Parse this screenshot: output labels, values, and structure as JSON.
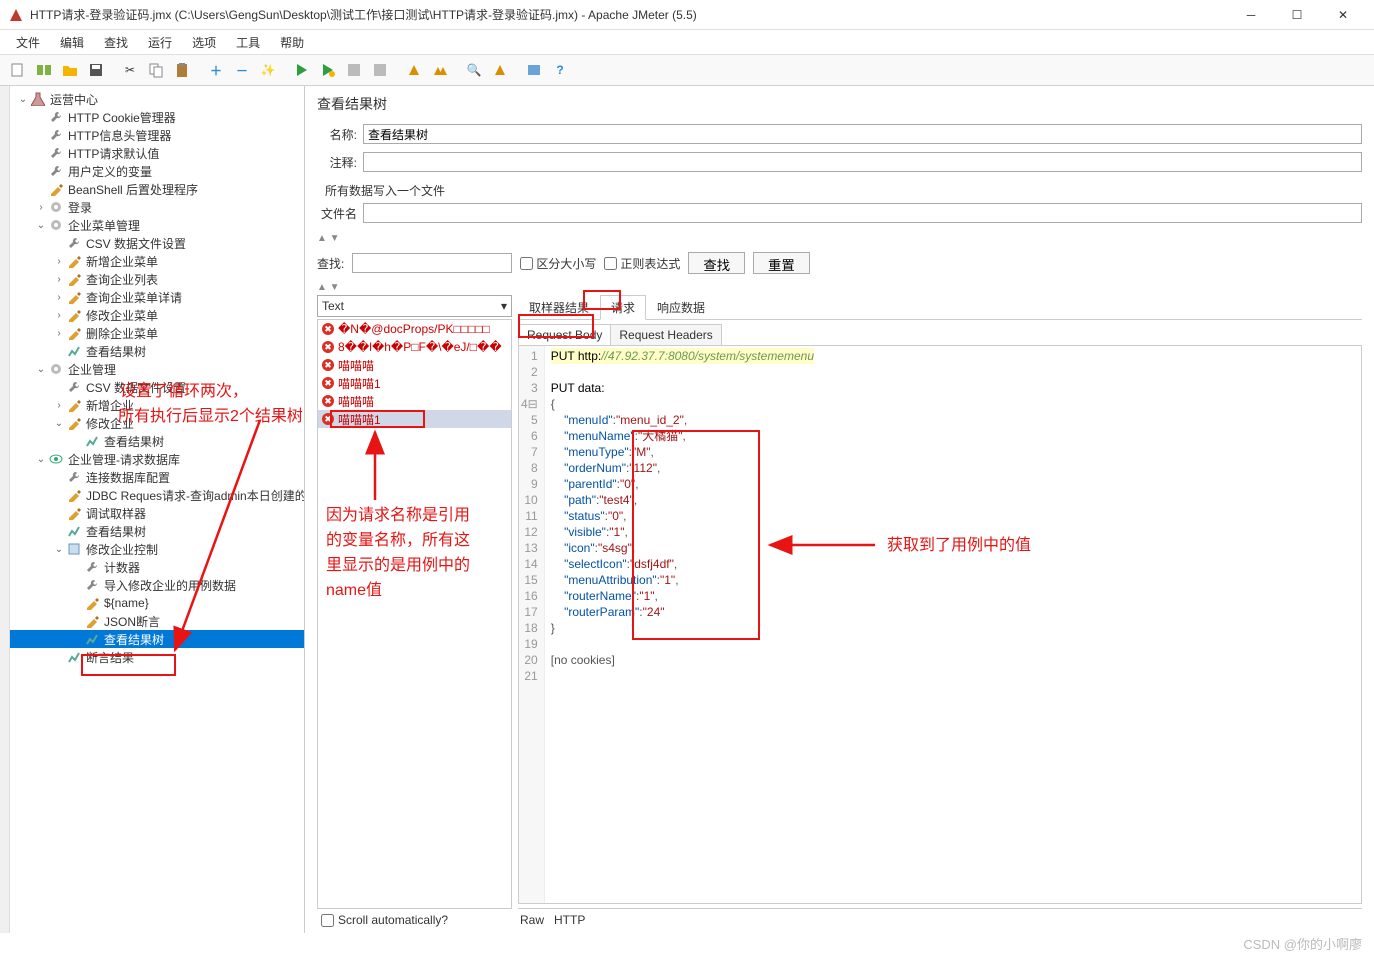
{
  "window": {
    "title": "HTTP请求-登录验证码.jmx (C:\\Users\\GengSun\\Desktop\\测试工作\\接口测试\\HTTP请求-登录验证码.jmx) - Apache JMeter (5.5)"
  },
  "menu": [
    "文件",
    "编辑",
    "查找",
    "运行",
    "选项",
    "工具",
    "帮助"
  ],
  "tree": [
    {
      "d": 0,
      "t": "v",
      "ic": "flask",
      "lbl": "运营中心"
    },
    {
      "d": 1,
      "t": "",
      "ic": "wrench",
      "lbl": "HTTP Cookie管理器"
    },
    {
      "d": 1,
      "t": "",
      "ic": "wrench",
      "lbl": "HTTP信息头管理器"
    },
    {
      "d": 1,
      "t": "",
      "ic": "wrench",
      "lbl": "HTTP请求默认值"
    },
    {
      "d": 1,
      "t": "",
      "ic": "wrench",
      "lbl": "用户定义的变量"
    },
    {
      "d": 1,
      "t": "",
      "ic": "pencil",
      "lbl": "BeanShell 后置处理程序"
    },
    {
      "d": 1,
      "t": ">",
      "ic": "gear",
      "lbl": "登录"
    },
    {
      "d": 1,
      "t": "v",
      "ic": "gear",
      "lbl": "企业菜单管理"
    },
    {
      "d": 2,
      "t": "",
      "ic": "wrench",
      "lbl": "CSV 数据文件设置"
    },
    {
      "d": 2,
      "t": ">",
      "ic": "pencil",
      "lbl": "新增企业菜单"
    },
    {
      "d": 2,
      "t": ">",
      "ic": "pencil",
      "lbl": "查询企业列表"
    },
    {
      "d": 2,
      "t": ">",
      "ic": "pencil",
      "lbl": "查询企业菜单详请"
    },
    {
      "d": 2,
      "t": ">",
      "ic": "pencil",
      "lbl": "修改企业菜单"
    },
    {
      "d": 2,
      "t": ">",
      "ic": "pencil",
      "lbl": "删除企业菜单"
    },
    {
      "d": 2,
      "t": "",
      "ic": "chart",
      "lbl": "查看结果树"
    },
    {
      "d": 1,
      "t": "v",
      "ic": "gear",
      "lbl": "企业管理"
    },
    {
      "d": 2,
      "t": "",
      "ic": "wrench",
      "lbl": "CSV 数据文件设置"
    },
    {
      "d": 2,
      "t": ">",
      "ic": "pencil",
      "lbl": "新增企业"
    },
    {
      "d": 2,
      "t": "v",
      "ic": "pencil",
      "lbl": "修改企业"
    },
    {
      "d": 3,
      "t": "",
      "ic": "chart",
      "lbl": "查看结果树"
    },
    {
      "d": 1,
      "t": "v",
      "ic": "eye",
      "lbl": "企业管理-请求数据库"
    },
    {
      "d": 2,
      "t": "",
      "ic": "wrench",
      "lbl": "连接数据库配置"
    },
    {
      "d": 2,
      "t": "",
      "ic": "pencil",
      "lbl": "JDBC Reques请求-查询admin本日创建的"
    },
    {
      "d": 2,
      "t": "",
      "ic": "pencil",
      "lbl": "调试取样器"
    },
    {
      "d": 2,
      "t": "",
      "ic": "chart",
      "lbl": "查看结果树"
    },
    {
      "d": 2,
      "t": "v",
      "ic": "box",
      "lbl": "修改企业控制"
    },
    {
      "d": 3,
      "t": "",
      "ic": "wrench",
      "lbl": "计数器"
    },
    {
      "d": 3,
      "t": "",
      "ic": "wrench",
      "lbl": "导入修改企业的用例数据"
    },
    {
      "d": 3,
      "t": "",
      "ic": "pencil",
      "lbl": "${name}"
    },
    {
      "d": 3,
      "t": "",
      "ic": "pencil",
      "lbl": "JSON断言"
    },
    {
      "d": 3,
      "t": "",
      "ic": "chart",
      "lbl": "查看结果树",
      "sel": true
    },
    {
      "d": 2,
      "t": "",
      "ic": "chart",
      "lbl": "断言结果"
    }
  ],
  "panel": {
    "header": "查看结果树",
    "name_label": "名称:",
    "name_value": "查看结果树",
    "comment_label": "注释:",
    "file_section": "所有数据写入一个文件",
    "file_label": "文件名",
    "search_label": "查找:",
    "case_label": "区分大小写",
    "regex_label": "正则表达式",
    "search_btn": "查找",
    "reset_btn": "重置",
    "dropdown": "Text",
    "scroll_auto": "Scroll automatically?"
  },
  "samples": [
    {
      "err": true,
      "lbl": "�N�@docProps/PK□□□□□"
    },
    {
      "err": true,
      "lbl": "8��l�h�P□F�\\�eJ/□��"
    },
    {
      "err": true,
      "lbl": "喵喵喵"
    },
    {
      "err": true,
      "lbl": "喵喵喵1"
    },
    {
      "err": true,
      "lbl": "喵喵喵"
    },
    {
      "err": true,
      "lbl": "喵喵喵1",
      "sel": true
    }
  ],
  "detail_tabs": [
    "取样器结果",
    "请求",
    "响应数据"
  ],
  "detail_tab_active": 1,
  "sub_tabs": [
    "Request Body",
    "Request Headers"
  ],
  "sub_tab_active": 0,
  "bottom_tabs": [
    "Raw",
    "HTTP"
  ],
  "code": {
    "line1_a": "PUT ",
    "line1_b": "http:",
    "line1_c": "//47.92.37.7:8080/system/systememenu",
    "line3": "PUT data:",
    "brace_open": "{",
    "rows": [
      {
        "k": "menuId",
        "v": "menu_id_2"
      },
      {
        "k": "menuName",
        "v": "大橘猫"
      },
      {
        "k": "menuType",
        "v": "M"
      },
      {
        "k": "orderNum",
        "v": "112"
      },
      {
        "k": "parentId",
        "v": "0"
      },
      {
        "k": "path",
        "v": "test4"
      },
      {
        "k": "status",
        "v": "0"
      },
      {
        "k": "visible",
        "v": "1"
      },
      {
        "k": "icon",
        "v": "s4sg"
      },
      {
        "k": "selectIcon",
        "v": "dsfj4df"
      },
      {
        "k": "menuAttribution",
        "v": "1"
      },
      {
        "k": "routerName",
        "v": "1"
      },
      {
        "k": "routerParam",
        "v": "24"
      }
    ],
    "brace_close": "}",
    "cookies": "[no cookies]"
  },
  "annotations": {
    "a1_l1": "设置了循环两次，",
    "a1_l2": "所有执行后显示2个结果树",
    "a2_l1": "因为请求名称是引用",
    "a2_l2": "的变量名称，所有这",
    "a2_l3": "里显示的是用例中的",
    "a2_l4": "name值",
    "a3": "获取到了用例中的值"
  },
  "footer": "CSDN @你的小啊廖"
}
